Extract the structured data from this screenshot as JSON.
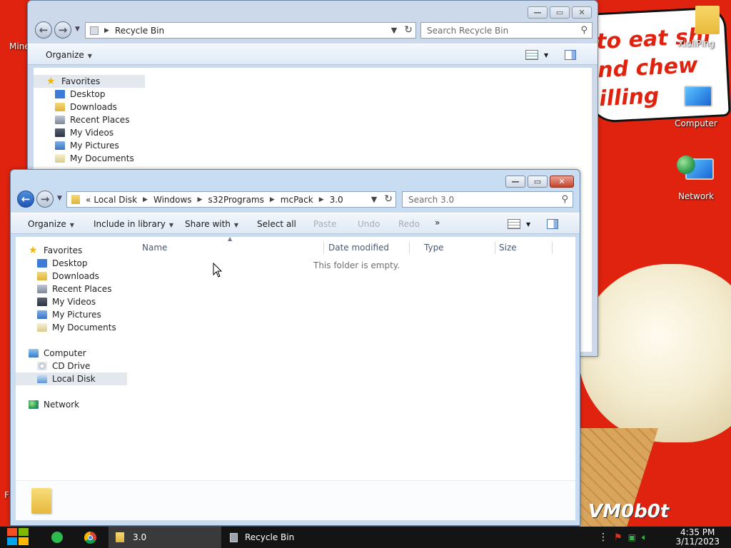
{
  "desktop": {
    "background_color": "#e0230f",
    "banner_lines": [
      "to eat shi",
      "nd chew",
      "illing"
    ],
    "watermark": "VM0b0t",
    "left_icon_label": "Mine",
    "left_cut_letter": "F",
    "icons": [
      {
        "label": "XiuliPing",
        "icon": "user-folder-icon"
      },
      {
        "label": "Computer",
        "icon": "computer-icon"
      },
      {
        "label": "Network",
        "icon": "network-icon"
      }
    ]
  },
  "back_window": {
    "address": {
      "location": "Recycle Bin"
    },
    "search_placeholder": "Search Recycle Bin",
    "toolbar": {
      "organize": "Organize"
    },
    "nav": {
      "favorites": "Favorites",
      "items": [
        "Desktop",
        "Downloads",
        "Recent Places",
        "My Videos",
        "My Pictures",
        "My Documents"
      ]
    }
  },
  "front_window": {
    "address": {
      "overflow": "«",
      "segments": [
        "Local Disk",
        "Windows",
        "s32Programs",
        "mcPack",
        "3.0"
      ]
    },
    "search_placeholder": "Search 3.0",
    "toolbar": {
      "organize": "Organize",
      "include_in_library": "Include in library",
      "share_with": "Share with",
      "select_all": "Select all",
      "paste": "Paste",
      "undo": "Undo",
      "redo": "Redo",
      "more": "»"
    },
    "nav": {
      "favorites": "Favorites",
      "favorite_items": [
        "Desktop",
        "Downloads",
        "Recent Places",
        "My Videos",
        "My Pictures",
        "My Documents"
      ],
      "computer": "Computer",
      "computer_items": [
        "CD Drive",
        "Local Disk"
      ],
      "network": "Network"
    },
    "columns": [
      "Name",
      "Date modified",
      "Type",
      "Size"
    ],
    "empty_message": "This folder is empty."
  },
  "taskbar": {
    "tasks": [
      {
        "label": "3.0",
        "icon": "folder-icon",
        "active": true
      },
      {
        "label": "Recycle Bin",
        "icon": "recycle-bin-icon",
        "active": false
      }
    ],
    "clock_time": "4:35 PM",
    "clock_date": "3/11/2023"
  },
  "colors": {
    "accent": "#1e55b5",
    "window_frame": "#c8dcf2",
    "taskbar": "#141414"
  }
}
